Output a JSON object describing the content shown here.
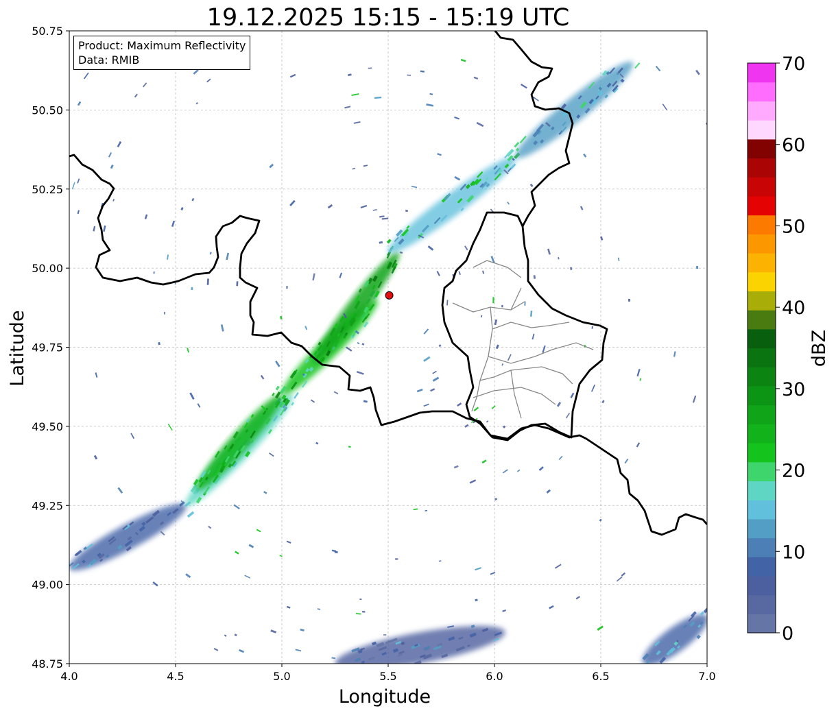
{
  "title": "19.12.2025 15:15 - 15:19 UTC",
  "info": {
    "product_line": "Product: Maximum Reflectivity",
    "data_line": "Data: RMIB"
  },
  "axes": {
    "xlabel": "Longitude",
    "ylabel": "Latitude",
    "xlim": [
      4.0,
      7.0
    ],
    "ylim": [
      48.75,
      50.75
    ],
    "xticks": [
      "4.0",
      "4.5",
      "5.0",
      "5.5",
      "6.0",
      "6.5",
      "7.0"
    ],
    "yticks": [
      "48.75",
      "49.00",
      "49.25",
      "49.50",
      "49.75",
      "50.00",
      "50.25",
      "50.50",
      "50.75"
    ],
    "grid": true
  },
  "colorbar": {
    "label": "dBZ",
    "ticks": [
      "0",
      "10",
      "20",
      "30",
      "40",
      "50",
      "60",
      "70"
    ],
    "range": [
      0,
      70
    ],
    "colors": [
      "#6575a6",
      "#5868a1",
      "#4c5f9e",
      "#4263a6",
      "#4c7fb5",
      "#529ec4",
      "#61c0dc",
      "#5fd6c3",
      "#3ed56c",
      "#14c41d",
      "#12b31a",
      "#10a418",
      "#0c9414",
      "#0b8412",
      "#0a7411",
      "#08600e",
      "#4a7b11",
      "#a9ad08",
      "#fbd400",
      "#fbb200",
      "#fc9700",
      "#fd7a00",
      "#e40202",
      "#c80404",
      "#aa0404",
      "#820202",
      "#ffd8ff",
      "#ffaaff",
      "#ff6dff",
      "#f035f0"
    ]
  },
  "radar_site": {
    "lon": 5.505,
    "lat": 49.914,
    "color": "#e01010"
  },
  "colors": {
    "echo_light": "#4c6aa8",
    "echo_mid": "#5fc4cf",
    "echo_heavy": "#0c9414",
    "border": "#000000",
    "admin": "#888888"
  },
  "chart_data": {
    "type": "heatmap",
    "title": "19.12.2025 15:15 - 15:19 UTC",
    "xlabel": "Longitude",
    "ylabel": "Latitude",
    "xlim": [
      4.0,
      7.0
    ],
    "ylim": [
      48.75,
      50.75
    ],
    "grid": true,
    "colorbar_label": "dBZ",
    "colorbar_range": [
      0,
      70
    ],
    "echo_bands": [
      {
        "from": [
          4.0,
          49.05
        ],
        "to": [
          4.55,
          49.25
        ],
        "dbz": 8
      },
      {
        "from": [
          4.55,
          49.25
        ],
        "to": [
          5.05,
          49.6
        ],
        "dbz": 18
      },
      {
        "from": [
          4.6,
          49.3
        ],
        "to": [
          5.0,
          49.6
        ],
        "dbz": 24
      },
      {
        "from": [
          5.0,
          49.6
        ],
        "to": [
          5.45,
          49.9
        ],
        "dbz": 22
      },
      {
        "from": [
          5.15,
          49.7
        ],
        "to": [
          5.55,
          50.05
        ],
        "dbz": 26
      },
      {
        "from": [
          5.5,
          50.05
        ],
        "to": [
          6.1,
          50.35
        ],
        "dbz": 16
      },
      {
        "from": [
          6.1,
          50.35
        ],
        "to": [
          6.65,
          50.65
        ],
        "dbz": 12
      },
      {
        "from": [
          5.25,
          48.75
        ],
        "to": [
          6.05,
          48.85
        ],
        "dbz": 6
      },
      {
        "from": [
          6.7,
          48.75
        ],
        "to": [
          7.0,
          48.9
        ],
        "dbz": 9
      }
    ]
  }
}
